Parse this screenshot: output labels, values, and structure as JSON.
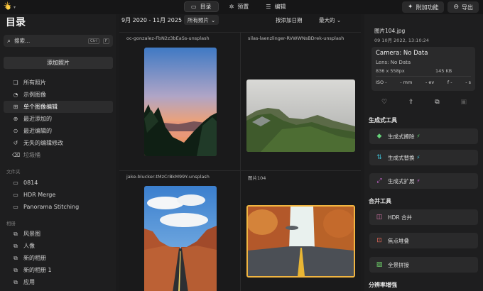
{
  "header": {
    "tabs": [
      {
        "label": "目录",
        "icon": "folder-icon"
      },
      {
        "label": "预置",
        "icon": "wand-icon"
      },
      {
        "label": "编辑",
        "icon": "sliders-icon"
      }
    ],
    "addon_label": "附加功能",
    "export_label": "导出"
  },
  "sidebar": {
    "title": "目录",
    "search_placeholder": "搜索...",
    "search_shortcut": [
      "Ctrl",
      "F"
    ],
    "add_photo_label": "添加照片",
    "library_items": [
      {
        "label": "所有照片",
        "icon": "photos-icon"
      },
      {
        "label": "示例图像",
        "icon": "samples-icon"
      },
      {
        "label": "单个图像编辑",
        "icon": "grid-icon"
      },
      {
        "label": "最近添加的",
        "icon": "clock-plus-icon"
      },
      {
        "label": "最近编辑的",
        "icon": "clock-edit-icon"
      },
      {
        "label": "无失的编辑修改",
        "icon": "undo-icon"
      },
      {
        "label": "垃圾桶",
        "icon": "trash-icon"
      }
    ],
    "folders_heading": "文件夹",
    "folders": [
      {
        "label": "0814",
        "icon": "folder-icon"
      },
      {
        "label": "HDR Merge",
        "icon": "folder-icon"
      },
      {
        "label": "Panorama Stitching",
        "icon": "folder-icon"
      }
    ],
    "albums_heading": "相册",
    "albums": [
      {
        "label": "风景图",
        "icon": "album-icon"
      },
      {
        "label": "人像",
        "icon": "album-icon"
      },
      {
        "label": "新的相册",
        "icon": "album-icon"
      },
      {
        "label": "新的相册 1",
        "icon": "album-icon"
      },
      {
        "label": "应用",
        "icon": "album-icon"
      }
    ]
  },
  "grid": {
    "date_range": "9月 2020 - 11月 2025",
    "filter_label": "所有照片",
    "sort_label": "按添加日期",
    "size_label": "最大的",
    "photos": [
      {
        "title": "oc-gonzalez-FbN2z3bEaSs-unsplash"
      },
      {
        "title": "silas-laenzlinger-RVWWNsBDrek-unsplash"
      },
      {
        "title": "jake-blucker-tMzCrBkM99Y-unsplash"
      },
      {
        "title": "图片104"
      }
    ]
  },
  "details": {
    "filename": "图片104.jpg",
    "date": "09 10月 2022, 13:10:24",
    "camera": "Camera: No Data",
    "lens": "Lens: No Data",
    "dimensions": "836 x 558px",
    "file_size": "145 KB",
    "iso": "ISO -",
    "shutter": "- mm",
    "ev": "- ev",
    "aperture": "f -",
    "speed": "- s",
    "generative_heading": "生成式工具",
    "generative_tools": [
      {
        "label": "生成式擦除",
        "icon": "eraser-icon"
      },
      {
        "label": "生成式替换",
        "icon": "replace-icon"
      },
      {
        "label": "生成式扩展",
        "icon": "expand-icon"
      }
    ],
    "merge_heading": "合并工具",
    "merge_tools": [
      {
        "label": "HDR 合并",
        "icon": "hdr-icon"
      },
      {
        "label": "焦点堆叠",
        "icon": "focus-icon"
      },
      {
        "label": "全景拼接",
        "icon": "panorama-icon"
      }
    ],
    "resolution_heading": "分辨率增强"
  }
}
